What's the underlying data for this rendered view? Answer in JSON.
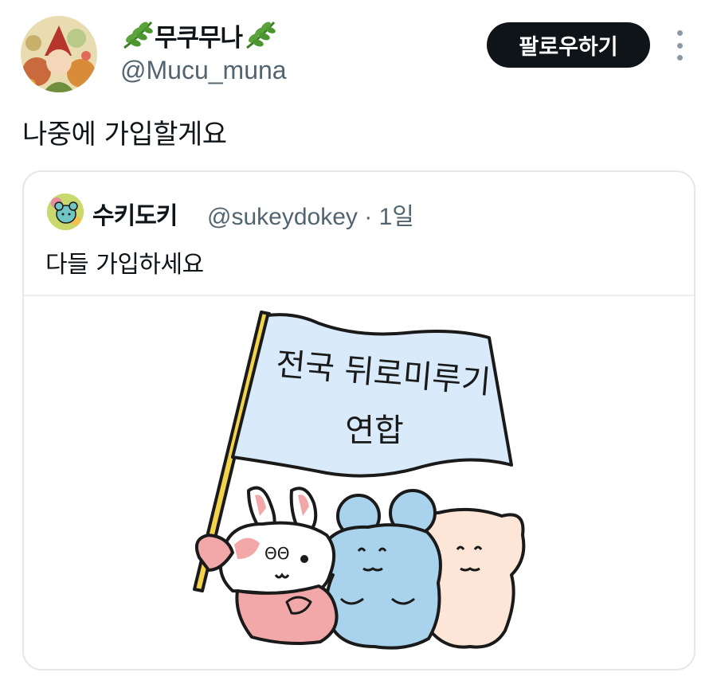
{
  "tweet": {
    "author": {
      "display_name": "무쿠무나",
      "handle": "@Mucu_muna"
    },
    "follow_label": "팔로우하기",
    "text": "나중에 가입할게요"
  },
  "quoted_tweet": {
    "author": {
      "display_name": "수키도키",
      "handle": "@sukeydokey",
      "separator": "·",
      "time": "1일"
    },
    "text": "다들 가입하세요",
    "image": {
      "banner_line1": "전국 뒤로미루기",
      "banner_line2": "연합"
    }
  },
  "icons": {
    "name_decoration": "leaf-icon",
    "menu": "more-vertical-icon"
  },
  "colors": {
    "text_primary": "#0f1419",
    "text_secondary": "#536471",
    "follow_bg": "#0f1419",
    "flag": "#d9ebfa",
    "bunny_pink": "#f2a8a8",
    "mouse_blue": "#a9d3ec",
    "bear_peach": "#fde6d8"
  }
}
